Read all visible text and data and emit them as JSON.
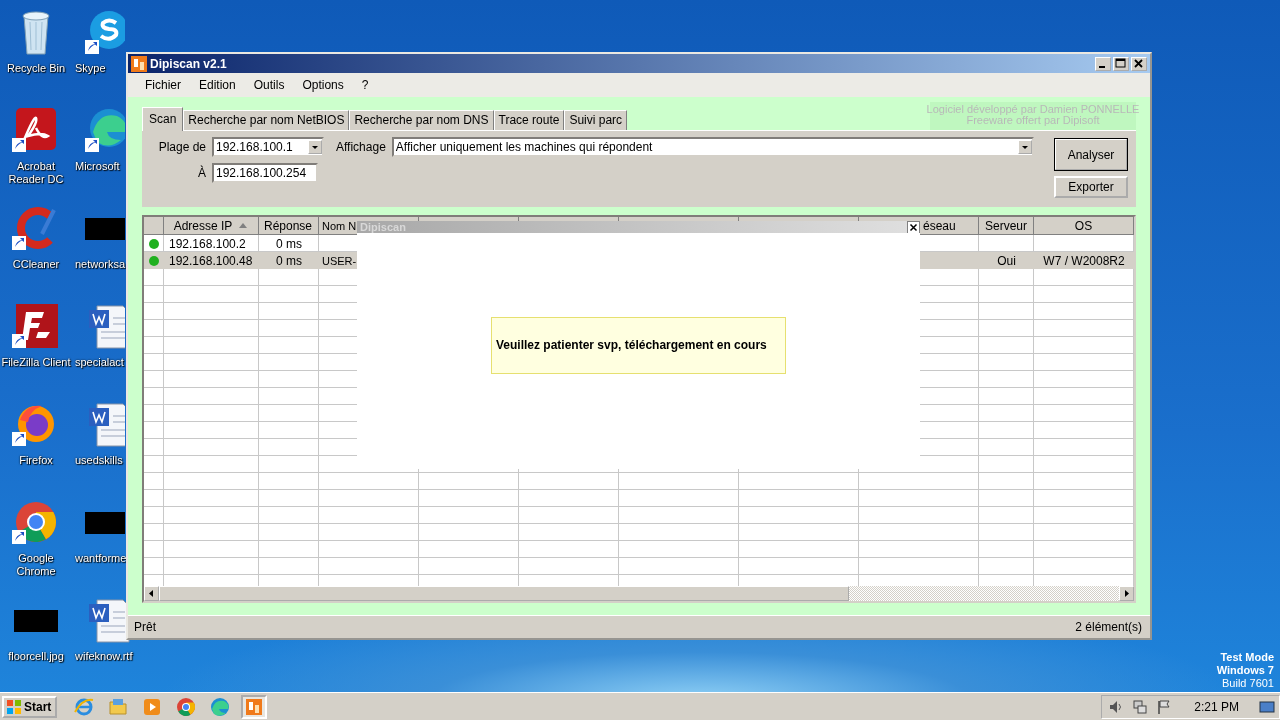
{
  "desktop": {
    "icons": [
      {
        "label": "Recycle Bin",
        "shortcut": false
      },
      {
        "label": "Skype",
        "shortcut": true
      },
      {
        "label": "Acrobat Reader DC",
        "shortcut": true
      },
      {
        "label": "Microsoft",
        "shortcut": true
      },
      {
        "label": "CCleaner",
        "shortcut": true
      },
      {
        "label": "networksa",
        "shortcut": false
      },
      {
        "label": "FileZilla Client",
        "shortcut": true
      },
      {
        "label": "specialact",
        "shortcut": false
      },
      {
        "label": "Firefox",
        "shortcut": true
      },
      {
        "label": "usedskills",
        "shortcut": false
      },
      {
        "label": "Google Chrome",
        "shortcut": true
      },
      {
        "label": "wantforme",
        "shortcut": false
      },
      {
        "label": "floorcell.jpg",
        "shortcut": false
      },
      {
        "label": "wifeknow.rtf",
        "shortcut": false
      }
    ],
    "system_badge": [
      "Test Mode",
      "Windows 7",
      "Build 7601"
    ]
  },
  "window": {
    "title": "Dipiscan v2.1",
    "menu": [
      "Fichier",
      "Edition",
      "Outils",
      "Options",
      "?"
    ],
    "credits": [
      "Logiciel développé par Damien PONNELLE",
      "Freeware offert par Dipisoft"
    ],
    "tabs": [
      {
        "label": "Scan",
        "selected": true
      },
      {
        "label": "Recherche par nom NetBIOS",
        "selected": false
      },
      {
        "label": "Recherche par nom DNS",
        "selected": false
      },
      {
        "label": "Trace route",
        "selected": false
      },
      {
        "label": "Suivi parc",
        "selected": false
      }
    ],
    "range": {
      "from_label": "Plage de",
      "from": "192.168.100.1",
      "to_label": "À",
      "to": "192.168.100.254"
    },
    "display": {
      "label": "Affichage",
      "value": "Afficher uniquement les machines qui répondent"
    },
    "buttons": [
      "Analyser",
      "Exporter"
    ],
    "table": {
      "columns": [
        {
          "label": "Adresse IP",
          "sorted": true
        },
        {
          "label": "Réponse"
        },
        {
          "label": "Nom N"
        },
        {
          "label": "éseau"
        },
        {
          "label": "Serveur"
        },
        {
          "label": "OS"
        }
      ],
      "rows": [
        {
          "color": "#20b020",
          "selected": false,
          "cells": [
            "192.168.100.2",
            "0 ms"
          ]
        },
        {
          "color": "#20b020",
          "selected": true,
          "cells": [
            "192.168.100.48",
            "0 ms",
            "USER-",
            null,
            "Oui",
            "W7 / W2008R2"
          ]
        }
      ]
    },
    "dialog": {
      "title": "Dipiscan",
      "message": "Veuillez patienter svp, téléchargement en cours"
    },
    "status_bar": [
      "Prêt",
      "2 élément(s)"
    ]
  },
  "taskbar": {
    "start": "Start",
    "apps": [
      {
        "selected": false
      },
      {
        "selected": false
      },
      {
        "selected": false
      },
      {
        "selected": false
      },
      {
        "selected": false
      },
      {
        "selected": true
      }
    ],
    "clock": "2:21 PM"
  }
}
